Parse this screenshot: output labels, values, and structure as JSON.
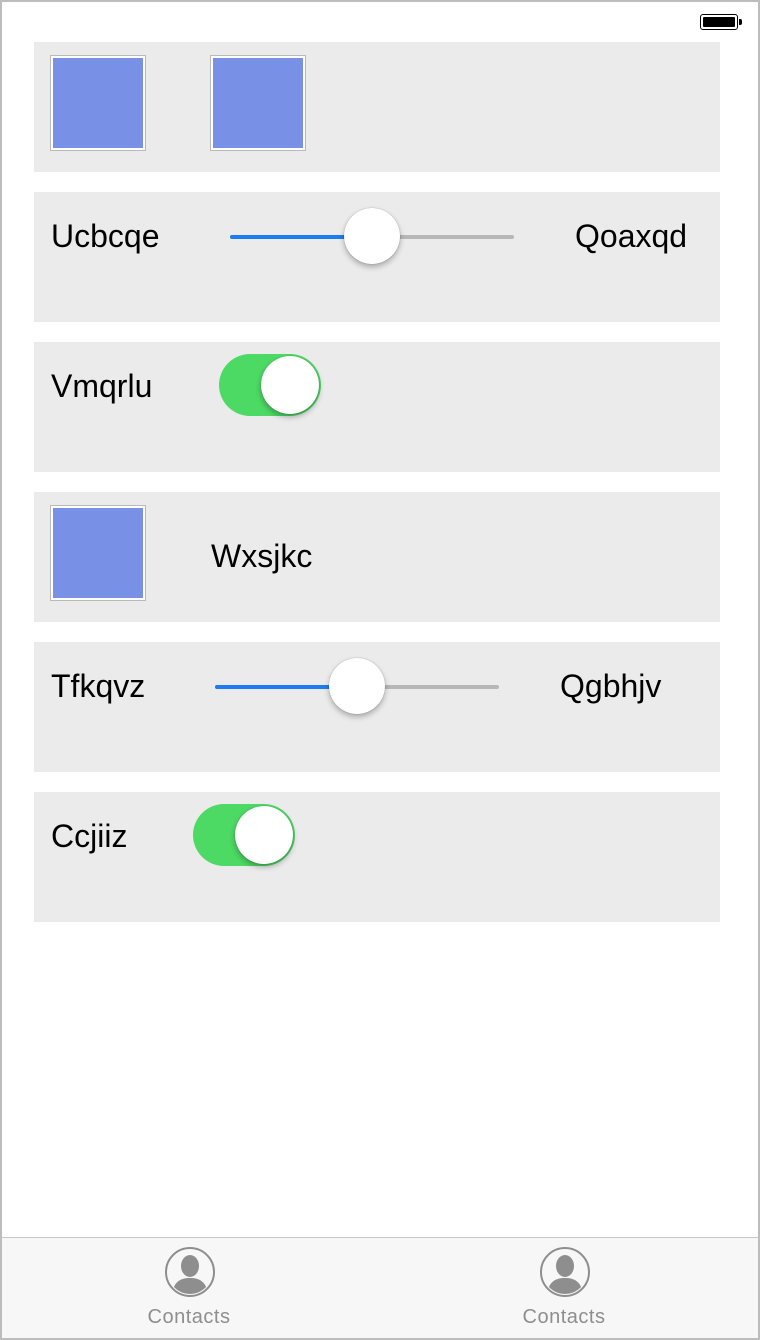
{
  "status_bar": {
    "battery_icon": "battery-full-icon",
    "battery_level": 1.0
  },
  "rows": {
    "slider1": {
      "left_label": "Ucbcqe",
      "right_label": "Qoaxqd",
      "value": 0.5
    },
    "switch1": {
      "label": "Vmqrlu",
      "on": true
    },
    "image_row": {
      "label": "Wxsjkc"
    },
    "slider2": {
      "left_label": "Tfkqvz",
      "right_label": "Qgbhjv",
      "value": 0.5
    },
    "switch2": {
      "label": "Ccjiiz",
      "on": true
    }
  },
  "colors": {
    "row_background": "#ebebeb",
    "image_placeholder": "#7891e6",
    "slider_active": "#1d7cf2",
    "slider_inactive": "#b7b7b7",
    "switch_on": "#4cd964",
    "tab_inactive": "#8e8e8e"
  },
  "tabbar": {
    "tabs": [
      {
        "label": "Contacts",
        "icon": "contact-person-icon"
      },
      {
        "label": "Contacts",
        "icon": "contact-person-icon"
      }
    ]
  }
}
